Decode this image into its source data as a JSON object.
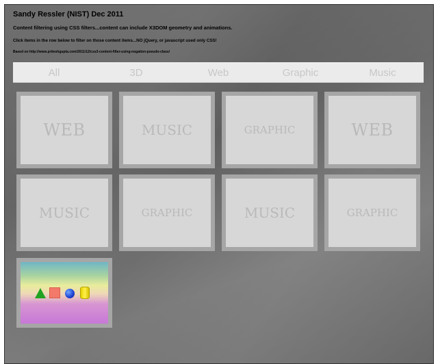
{
  "header": {
    "title": "Sandy Ressler (NIST) Dec 2011",
    "line1": "Content filtering using CSS filters...content can include X3DOM geometry and animations.",
    "line2": "Click items in the row below to filter on those content items...NO jQuery, or javascript used only CSS!",
    "line3": "Based on http://www.priteshgupta.com/2011/12/css3-content-filter-using-negation-pseudo-class/"
  },
  "filters": [
    "All",
    "3D",
    "Web",
    "Graphic",
    "Music"
  ],
  "cards": [
    {
      "label": "WEB"
    },
    {
      "label": "MUSIC"
    },
    {
      "label": "GRAPHIC"
    },
    {
      "label": "WEB"
    },
    {
      "label": "MUSIC"
    },
    {
      "label": "GRAPHIC"
    },
    {
      "label": "MUSIC"
    },
    {
      "label": "GRAPHIC"
    }
  ],
  "x3d_card": {
    "shapes": [
      "cone-icon",
      "box-icon",
      "sphere-icon",
      "cylinder-icon"
    ],
    "shape_colors": {
      "cone": "#21a321",
      "box": "#f37a6a",
      "sphere": "#1b3fd1",
      "cylinder": "#fff04a"
    }
  },
  "colors": {
    "background": "#6a6a6a",
    "filterbar": "#ebebeb",
    "filter_text": "#c7c7c7",
    "card_border": "#a6a6a6",
    "card_face": "#d7d7d7",
    "card_text": "#b9b9b9"
  }
}
